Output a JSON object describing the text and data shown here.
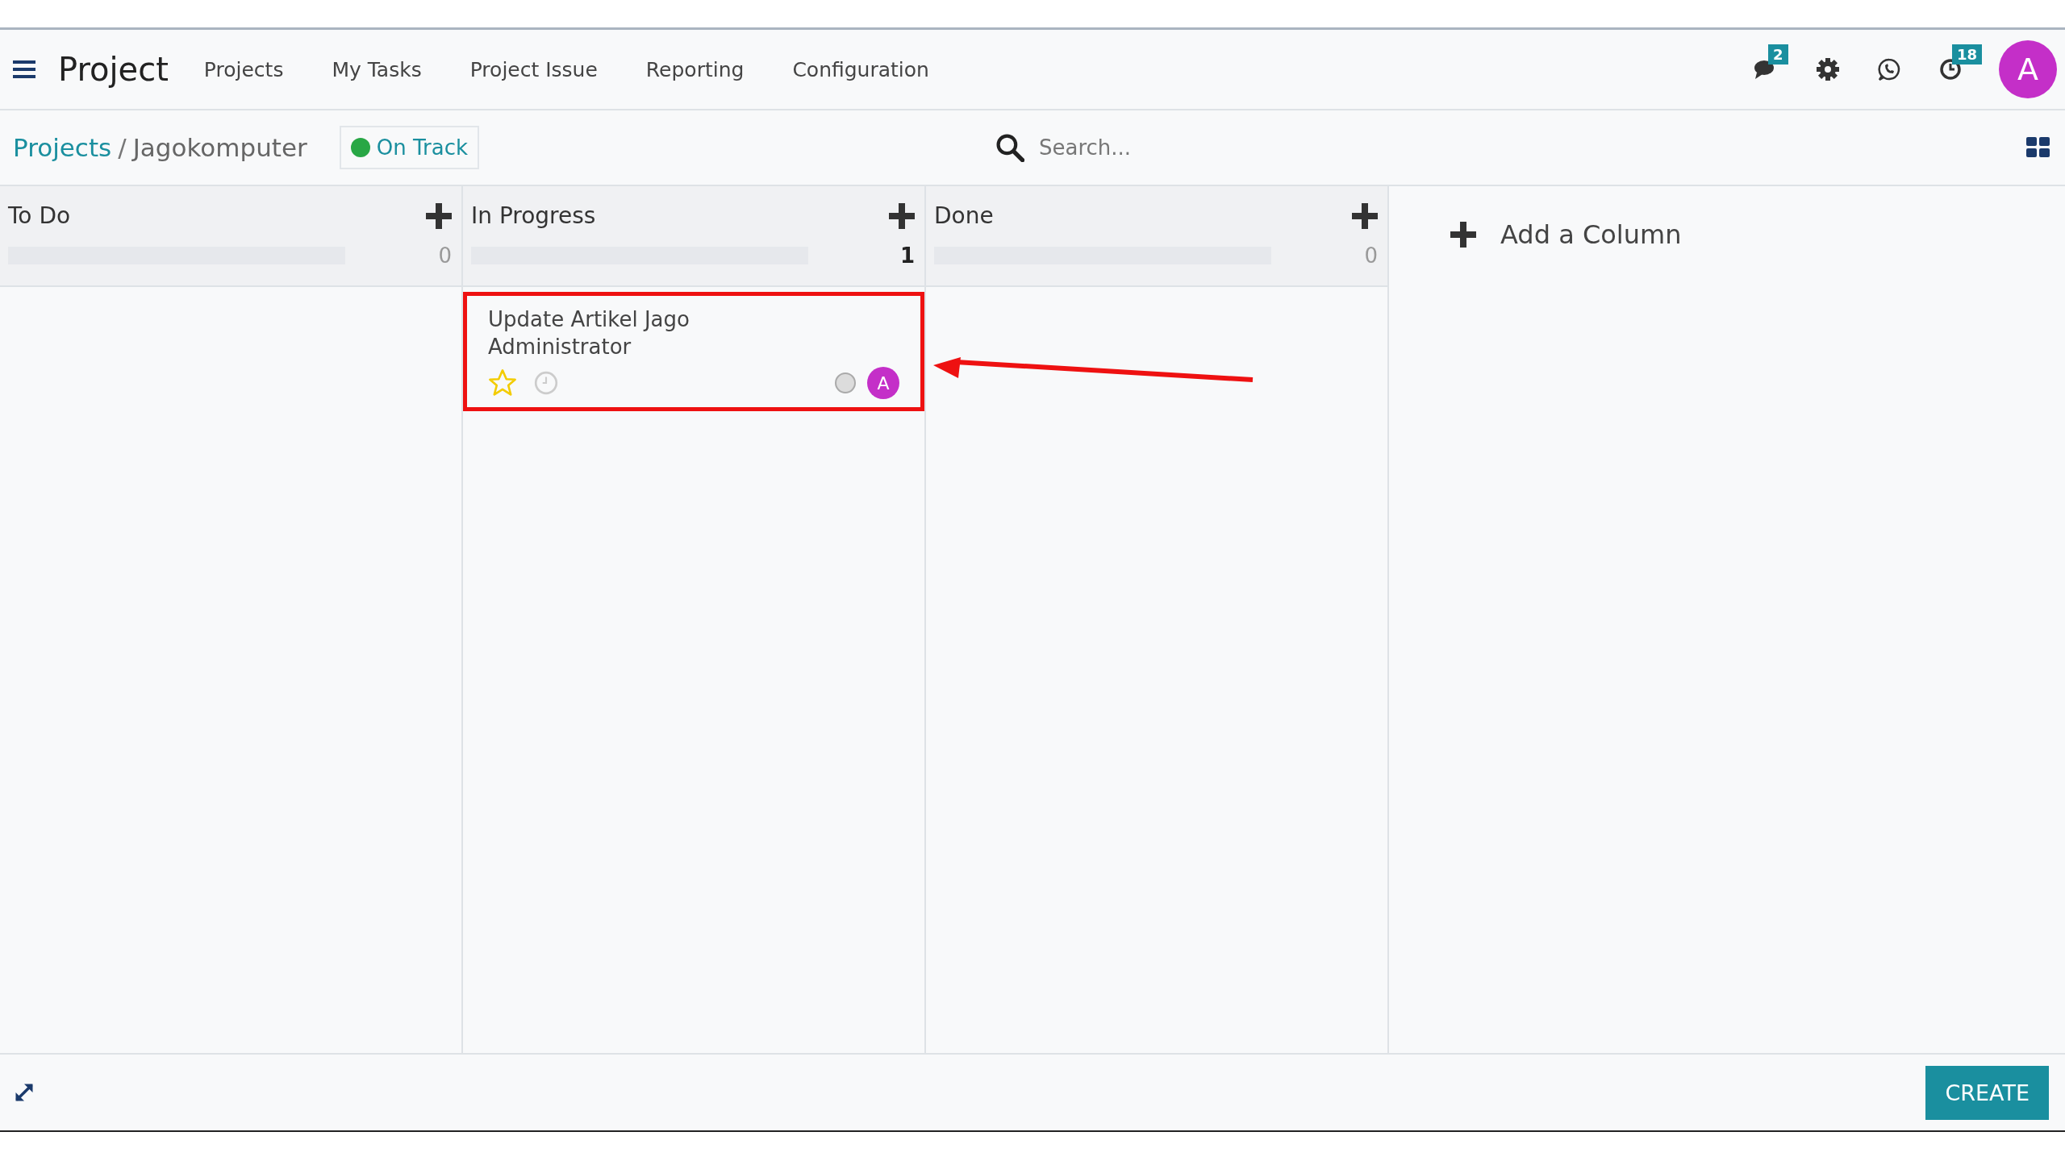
{
  "navbar": {
    "app_title": "Project",
    "menu": [
      "Projects",
      "My Tasks",
      "Project Issue",
      "Reporting",
      "Configuration"
    ],
    "messages_badge": "2",
    "activities_badge": "18",
    "avatar_letter": "A"
  },
  "control_bar": {
    "breadcrumb": [
      "Projects",
      "Jagokomputer"
    ],
    "breadcrumb_separator": "/",
    "status": {
      "label": "On Track",
      "color": "#28a745"
    },
    "search": {
      "placeholder": "Search..."
    }
  },
  "columns": [
    {
      "title": "To Do",
      "count": "0",
      "level": 0
    },
    {
      "title": "In Progress",
      "count": "1",
      "level": 0,
      "cards": [
        {
          "title": "Update Artikel Jago",
          "assignee": "Administrator",
          "starred": false,
          "avatar_letter": "A",
          "highlighted": true
        }
      ]
    },
    {
      "title": "Done",
      "count": "0",
      "level": 0
    }
  ],
  "add_column": "Add a Column",
  "footer": {
    "create_button": "CREATE"
  }
}
